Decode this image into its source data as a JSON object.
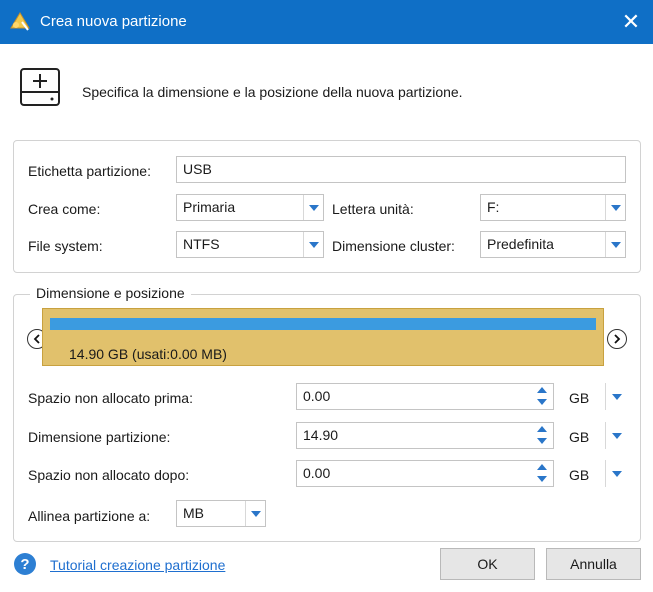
{
  "titlebar": {
    "title": "Crea nuova partizione",
    "close_glyph": "✕"
  },
  "header": {
    "description": "Specifica la dimensione e la posizione della nuova partizione."
  },
  "settings": {
    "label_label": "Etichetta partizione:",
    "label_value": "USB",
    "create_as_label": "Crea come:",
    "create_as_value": "Primaria",
    "drive_letter_label": "Lettera unità:",
    "drive_letter_value": "F:",
    "fs_label": "File system:",
    "fs_value": "NTFS",
    "cluster_label": "Dimensione cluster:",
    "cluster_value": "Predefinita"
  },
  "size_position": {
    "legend": "Dimensione e posizione",
    "bar_caption": "14.90 GB (usati:0.00 MB)",
    "unalloc_before_label": "Spazio non allocato prima:",
    "unalloc_before_value": "0.00",
    "partition_size_label": "Dimensione partizione:",
    "partition_size_value": "14.90",
    "unalloc_after_label": "Spazio non allocato dopo:",
    "unalloc_after_value": "0.00",
    "unit": "GB",
    "align_label": "Allinea partizione a:",
    "align_value": "MB"
  },
  "footer": {
    "help_glyph": "?",
    "tutorial_link": "Tutorial creazione partizione",
    "ok": "OK",
    "cancel": "Annulla"
  },
  "colors": {
    "titlebar": "#0f6fc6",
    "accent": "#2a76c9",
    "bar_fill": "#3b9be0",
    "bar_bg": "#e1c16c"
  },
  "icons": {
    "app": "partition-wizard-app-icon",
    "drive": "add-drive-icon",
    "left": "arrow-left-icon",
    "right": "arrow-right-icon",
    "help": "help-icon"
  }
}
